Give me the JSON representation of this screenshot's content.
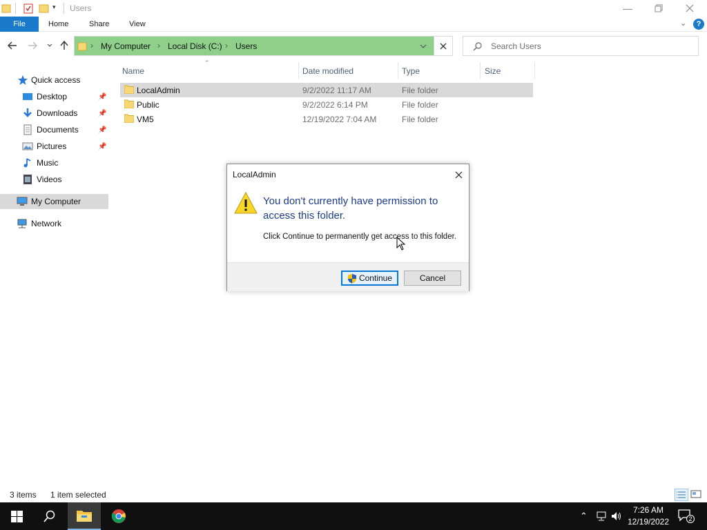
{
  "window": {
    "title": "Users"
  },
  "ribbon": {
    "file": "File",
    "home": "Home",
    "share": "Share",
    "view": "View"
  },
  "address": {
    "segments": [
      "My Computer",
      "Local Disk (C:)",
      "Users"
    ]
  },
  "search": {
    "placeholder": "Search Users"
  },
  "sidebar": {
    "items": [
      {
        "label": "Quick access",
        "icon": "star-icon"
      },
      {
        "label": "Desktop",
        "icon": "desktop-icon",
        "pinned": true
      },
      {
        "label": "Downloads",
        "icon": "downloads-icon",
        "pinned": true
      },
      {
        "label": "Documents",
        "icon": "documents-icon",
        "pinned": true
      },
      {
        "label": "Pictures",
        "icon": "pictures-icon",
        "pinned": true
      },
      {
        "label": "Music",
        "icon": "music-icon"
      },
      {
        "label": "Videos",
        "icon": "videos-icon"
      },
      {
        "label": "My Computer",
        "icon": "computer-icon",
        "selected": true
      },
      {
        "label": "Network",
        "icon": "network-icon"
      }
    ]
  },
  "columns": {
    "name": "Name",
    "date": "Date modified",
    "type": "Type",
    "size": "Size"
  },
  "files": [
    {
      "name": "LocalAdmin",
      "date": "9/2/2022 11:17 AM",
      "type": "File folder",
      "selected": true
    },
    {
      "name": "Public",
      "date": "9/2/2022 6:14 PM",
      "type": "File folder"
    },
    {
      "name": "VM5",
      "date": "12/19/2022 7:04 AM",
      "type": "File folder"
    }
  ],
  "status": {
    "count": "3 items",
    "selection": "1 item selected"
  },
  "dialog": {
    "title": "LocalAdmin",
    "message": "You don't currently have permission to access this folder.",
    "detail": "Click Continue to permanently get access to this folder.",
    "continue": "Continue",
    "cancel": "Cancel"
  },
  "taskbar": {
    "time": "7:26 AM",
    "date": "12/19/2022",
    "notifications": "2"
  },
  "colors": {
    "accent": "#1979ca",
    "address_bg": "#8ed08a",
    "selection": "#d9d9d9",
    "dialog_heading": "#1c3c8c"
  }
}
